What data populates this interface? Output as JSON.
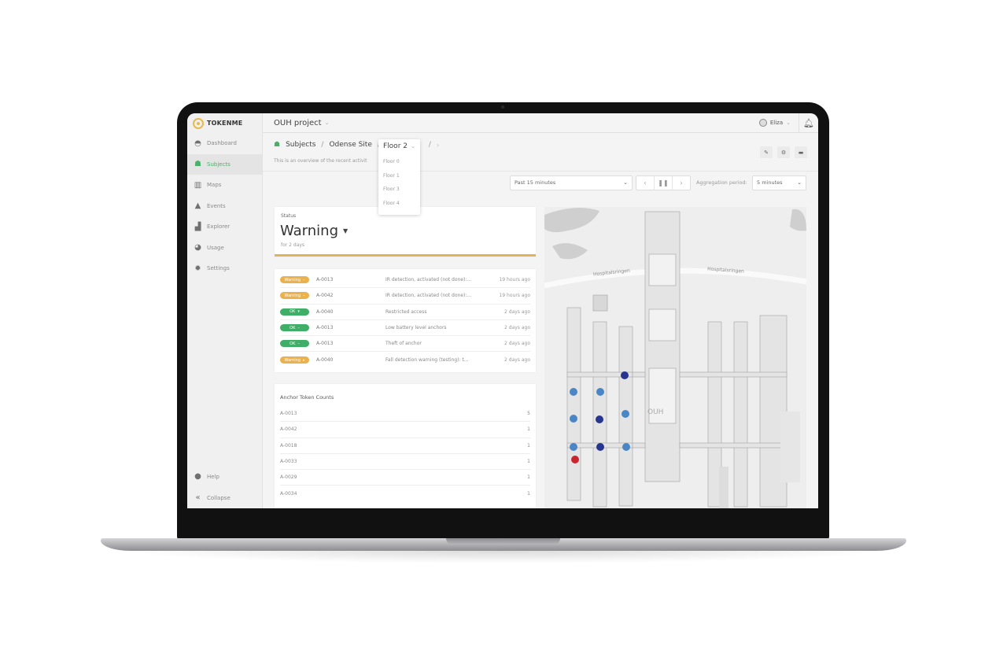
{
  "app": {
    "brand": "TOKENME",
    "project": "OUH project",
    "user": "Eliza"
  },
  "sidebar": {
    "items": [
      {
        "label": "Dashboard",
        "icon": "dashboard-icon",
        "active": false
      },
      {
        "label": "Subjects",
        "icon": "subjects-icon",
        "active": true
      },
      {
        "label": "Maps",
        "icon": "maps-icon",
        "active": false
      },
      {
        "label": "Events",
        "icon": "events-icon",
        "active": false
      },
      {
        "label": "Explorer",
        "icon": "explorer-icon",
        "active": false
      },
      {
        "label": "Usage",
        "icon": "usage-icon",
        "active": false
      },
      {
        "label": "Settings",
        "icon": "settings-icon",
        "active": false
      }
    ],
    "bottom": [
      {
        "label": "Help",
        "icon": "help-icon"
      },
      {
        "label": "Collapse",
        "icon": "collapse-icon"
      }
    ]
  },
  "breadcrumb": {
    "items": [
      "Subjects",
      "Odense Site",
      "Floor 2"
    ],
    "separator": "/",
    "subtitle": "This is an overview of the recent activit"
  },
  "floor_dropdown": {
    "selected": "Floor 2",
    "options": [
      "Floor 0",
      "Floor 1",
      "Floor 3",
      "Floor 4"
    ]
  },
  "controls": {
    "time_range": "Past 15 minutes",
    "aggregation_label": "Aggregation period:",
    "aggregation_value": "5 minutes"
  },
  "status": {
    "label": "Status",
    "value": "Warning",
    "since": "for 2 days",
    "accent_color": "#e0b45a"
  },
  "events": [
    {
      "status": "Warning",
      "type": "warning",
      "anchor": "A-0013",
      "description": "IR detection, activated (not done):...",
      "time": "19 hours ago"
    },
    {
      "status": "Warning",
      "type": "warning",
      "anchor": "A-0042",
      "description": "IR detection, activated (not done):...",
      "time": "19 hours ago"
    },
    {
      "status": "OK",
      "type": "ok",
      "anchor": "A-0040",
      "description": "Restricted access",
      "time": "2 days ago"
    },
    {
      "status": "OK",
      "type": "ok",
      "anchor": "A-0013",
      "description": "Low battery level anchors",
      "time": "2 days ago"
    },
    {
      "status": "OK",
      "type": "ok",
      "anchor": "A-0013",
      "description": "Theft of anchor",
      "time": "2 days ago"
    },
    {
      "status": "Warning",
      "type": "warning",
      "anchor": "A-0040",
      "description": "Fall detection warning (testing): t...",
      "time": "2 days ago"
    }
  ],
  "anchor_counts": {
    "title": "Anchor Token Counts",
    "rows": [
      {
        "anchor": "A-0013",
        "count": "5"
      },
      {
        "anchor": "A-0042",
        "count": "1"
      },
      {
        "anchor": "A-0018",
        "count": "1"
      },
      {
        "anchor": "A-0033",
        "count": "1"
      },
      {
        "anchor": "A-0029",
        "count": "1"
      },
      {
        "anchor": "A-0034",
        "count": "1"
      }
    ]
  },
  "map": {
    "road_labels": [
      "Hospitalsringen",
      "Hospitalsringen"
    ],
    "building_label": "OUH",
    "marker_colors": {
      "light": "#4a86c5",
      "dark": "#26358f",
      "alert": "#c8252f"
    }
  },
  "colors": {
    "warning": "#e9b24f",
    "ok": "#3fae66",
    "active_nav": "#4caf6a"
  }
}
